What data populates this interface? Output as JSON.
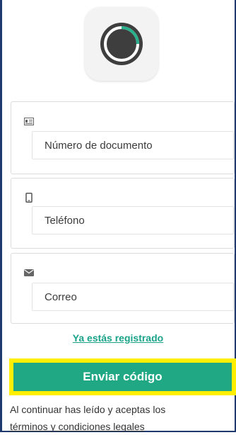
{
  "app": {
    "logo_icon": "app-logo-icon"
  },
  "form": {
    "document_field": {
      "icon": "id-card-icon",
      "placeholder": "Número de documento"
    },
    "phone_field": {
      "icon": "phone-icon",
      "placeholder": "Teléfono"
    },
    "email_field": {
      "icon": "envelope-icon",
      "placeholder": "Correo"
    }
  },
  "links": {
    "already_registered": "Ya estás registrado"
  },
  "actions": {
    "send_code": "Enviar código"
  },
  "legal": {
    "prefix": "Al continuar has leído y aceptas los",
    "terms_link": "términos y condiciones legales"
  },
  "colors": {
    "accent": "#20a783",
    "link": "#1aa389",
    "highlight": "#ffee00",
    "frame": "#1e3a6e"
  }
}
